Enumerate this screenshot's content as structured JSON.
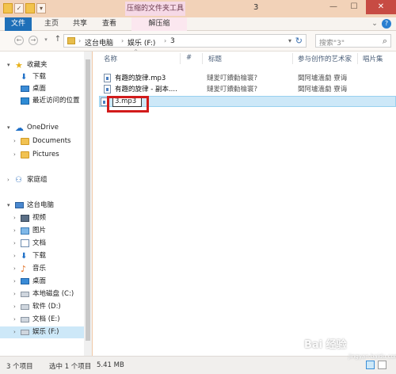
{
  "window": {
    "title": "3",
    "context_tab": "压缩的文件夹工具",
    "controls": {
      "minimize": "—",
      "maximize": "☐",
      "close": "✕"
    }
  },
  "ribbon": {
    "file": "文件",
    "home": "主页",
    "share": "共享",
    "view": "查看",
    "extract": "解压缩"
  },
  "address": {
    "crumbs": [
      "这台电脑",
      "娱乐 (F:)",
      "3"
    ],
    "search_placeholder": "搜索\"3\""
  },
  "nav": {
    "favorites": "收藏夹",
    "downloads": "下载",
    "desktop": "桌面",
    "recent": "最近访问的位置",
    "onedrive": "OneDrive",
    "documents": "Documents",
    "pictures": "Pictures",
    "homegroup": "家庭组",
    "thispc": "这台电脑",
    "videos": "视频",
    "images": "图片",
    "docs": "文档",
    "dl": "下载",
    "music": "音乐",
    "desk2": "桌面",
    "drive_c": "本地磁盘 (C:)",
    "drive_d": "软件 (D:)",
    "drive_e": "文档 (E:)",
    "drive_f": "娱乐 (F:)"
  },
  "columns": {
    "name": "名称",
    "number": "#",
    "title": "标题",
    "artist": "参与创作的艺术家",
    "album": "唱片集"
  },
  "files": [
    {
      "name": "有趣的旋律.mp3",
      "title": "鏈夎叮鐨勬棆寰?",
      "artist": "闆阿壚濇勮  寮诲"
    },
    {
      "name": "有趣的旋律 - 副本....",
      "title": "鏈夎叮鐨勬棆寰?",
      "artist": "闆阿壚濇勮  寮诲"
    }
  ],
  "rename_value": "3.mp3",
  "status": {
    "count": "3 个项目",
    "selected": "选中 1 个项目",
    "size": "5.41 MB"
  },
  "watermark": {
    "logo": "Bai 经验",
    "url": "jingyan.baidu.com"
  }
}
